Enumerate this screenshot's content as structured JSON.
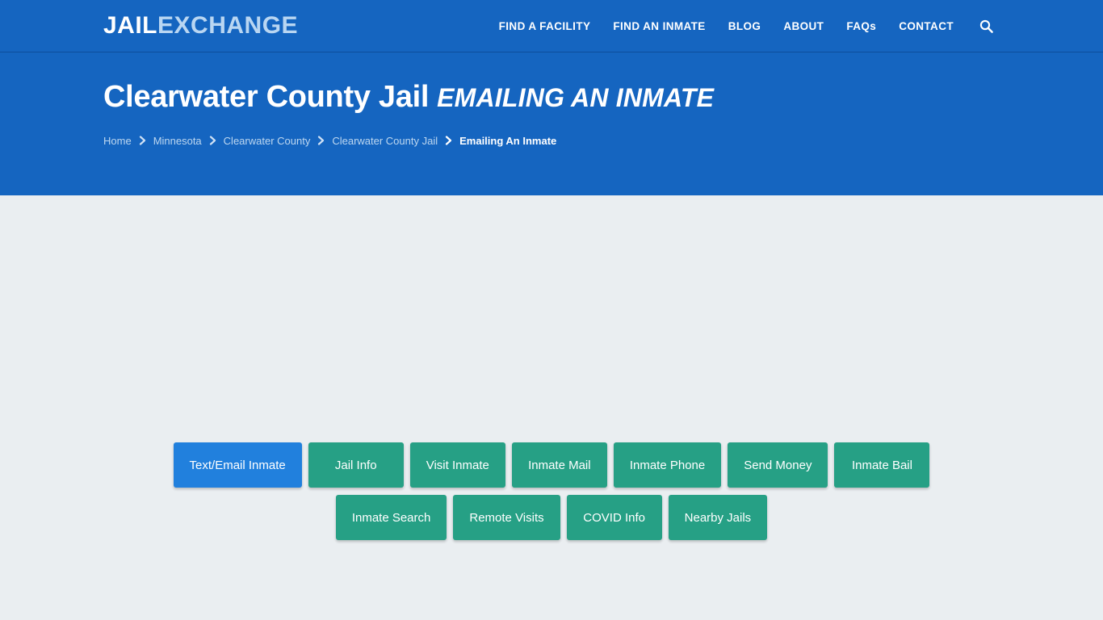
{
  "brand": {
    "part1": "JAIL",
    "part2": "EXCHANGE"
  },
  "nav": {
    "items": [
      {
        "label": "FIND A FACILITY",
        "name": "nav-find-a-facility"
      },
      {
        "label": "FIND AN INMATE",
        "name": "nav-find-an-inmate"
      },
      {
        "label": "BLOG",
        "name": "nav-blog"
      },
      {
        "label": "ABOUT",
        "name": "nav-about"
      },
      {
        "label": "FAQs",
        "name": "nav-faqs"
      },
      {
        "label": "CONTACT",
        "name": "nav-contact"
      }
    ],
    "search_icon": "search-icon"
  },
  "hero": {
    "title_main": "Clearwater County Jail",
    "title_sub": "EMAILING AN INMATE",
    "breadcrumb": [
      {
        "label": "Home",
        "current": false
      },
      {
        "label": "Minnesota",
        "current": false
      },
      {
        "label": "Clearwater County",
        "current": false
      },
      {
        "label": "Clearwater County Jail",
        "current": false
      },
      {
        "label": "Emailing An Inmate",
        "current": true
      }
    ],
    "separator_icon": "chevron-right-icon"
  },
  "main": {
    "button_rows": [
      [
        {
          "label": "Text/Email Inmate",
          "active": true
        },
        {
          "label": "Jail Info",
          "active": false
        },
        {
          "label": "Visit Inmate",
          "active": false
        },
        {
          "label": "Inmate Mail",
          "active": false
        },
        {
          "label": "Inmate Phone",
          "active": false
        },
        {
          "label": "Send Money",
          "active": false
        },
        {
          "label": "Inmate Bail",
          "active": false
        }
      ],
      [
        {
          "label": "Inmate Search",
          "active": false
        },
        {
          "label": "Remote Visits",
          "active": false
        },
        {
          "label": "COVID Info",
          "active": false
        },
        {
          "label": "Nearby Jails",
          "active": false
        }
      ]
    ]
  },
  "colors": {
    "header_blue": "#1565c0",
    "accent_teal": "#26a085",
    "active_blue": "#2180dd",
    "body_gray": "#eaeef1",
    "brand_light": "#b9d6f2"
  }
}
